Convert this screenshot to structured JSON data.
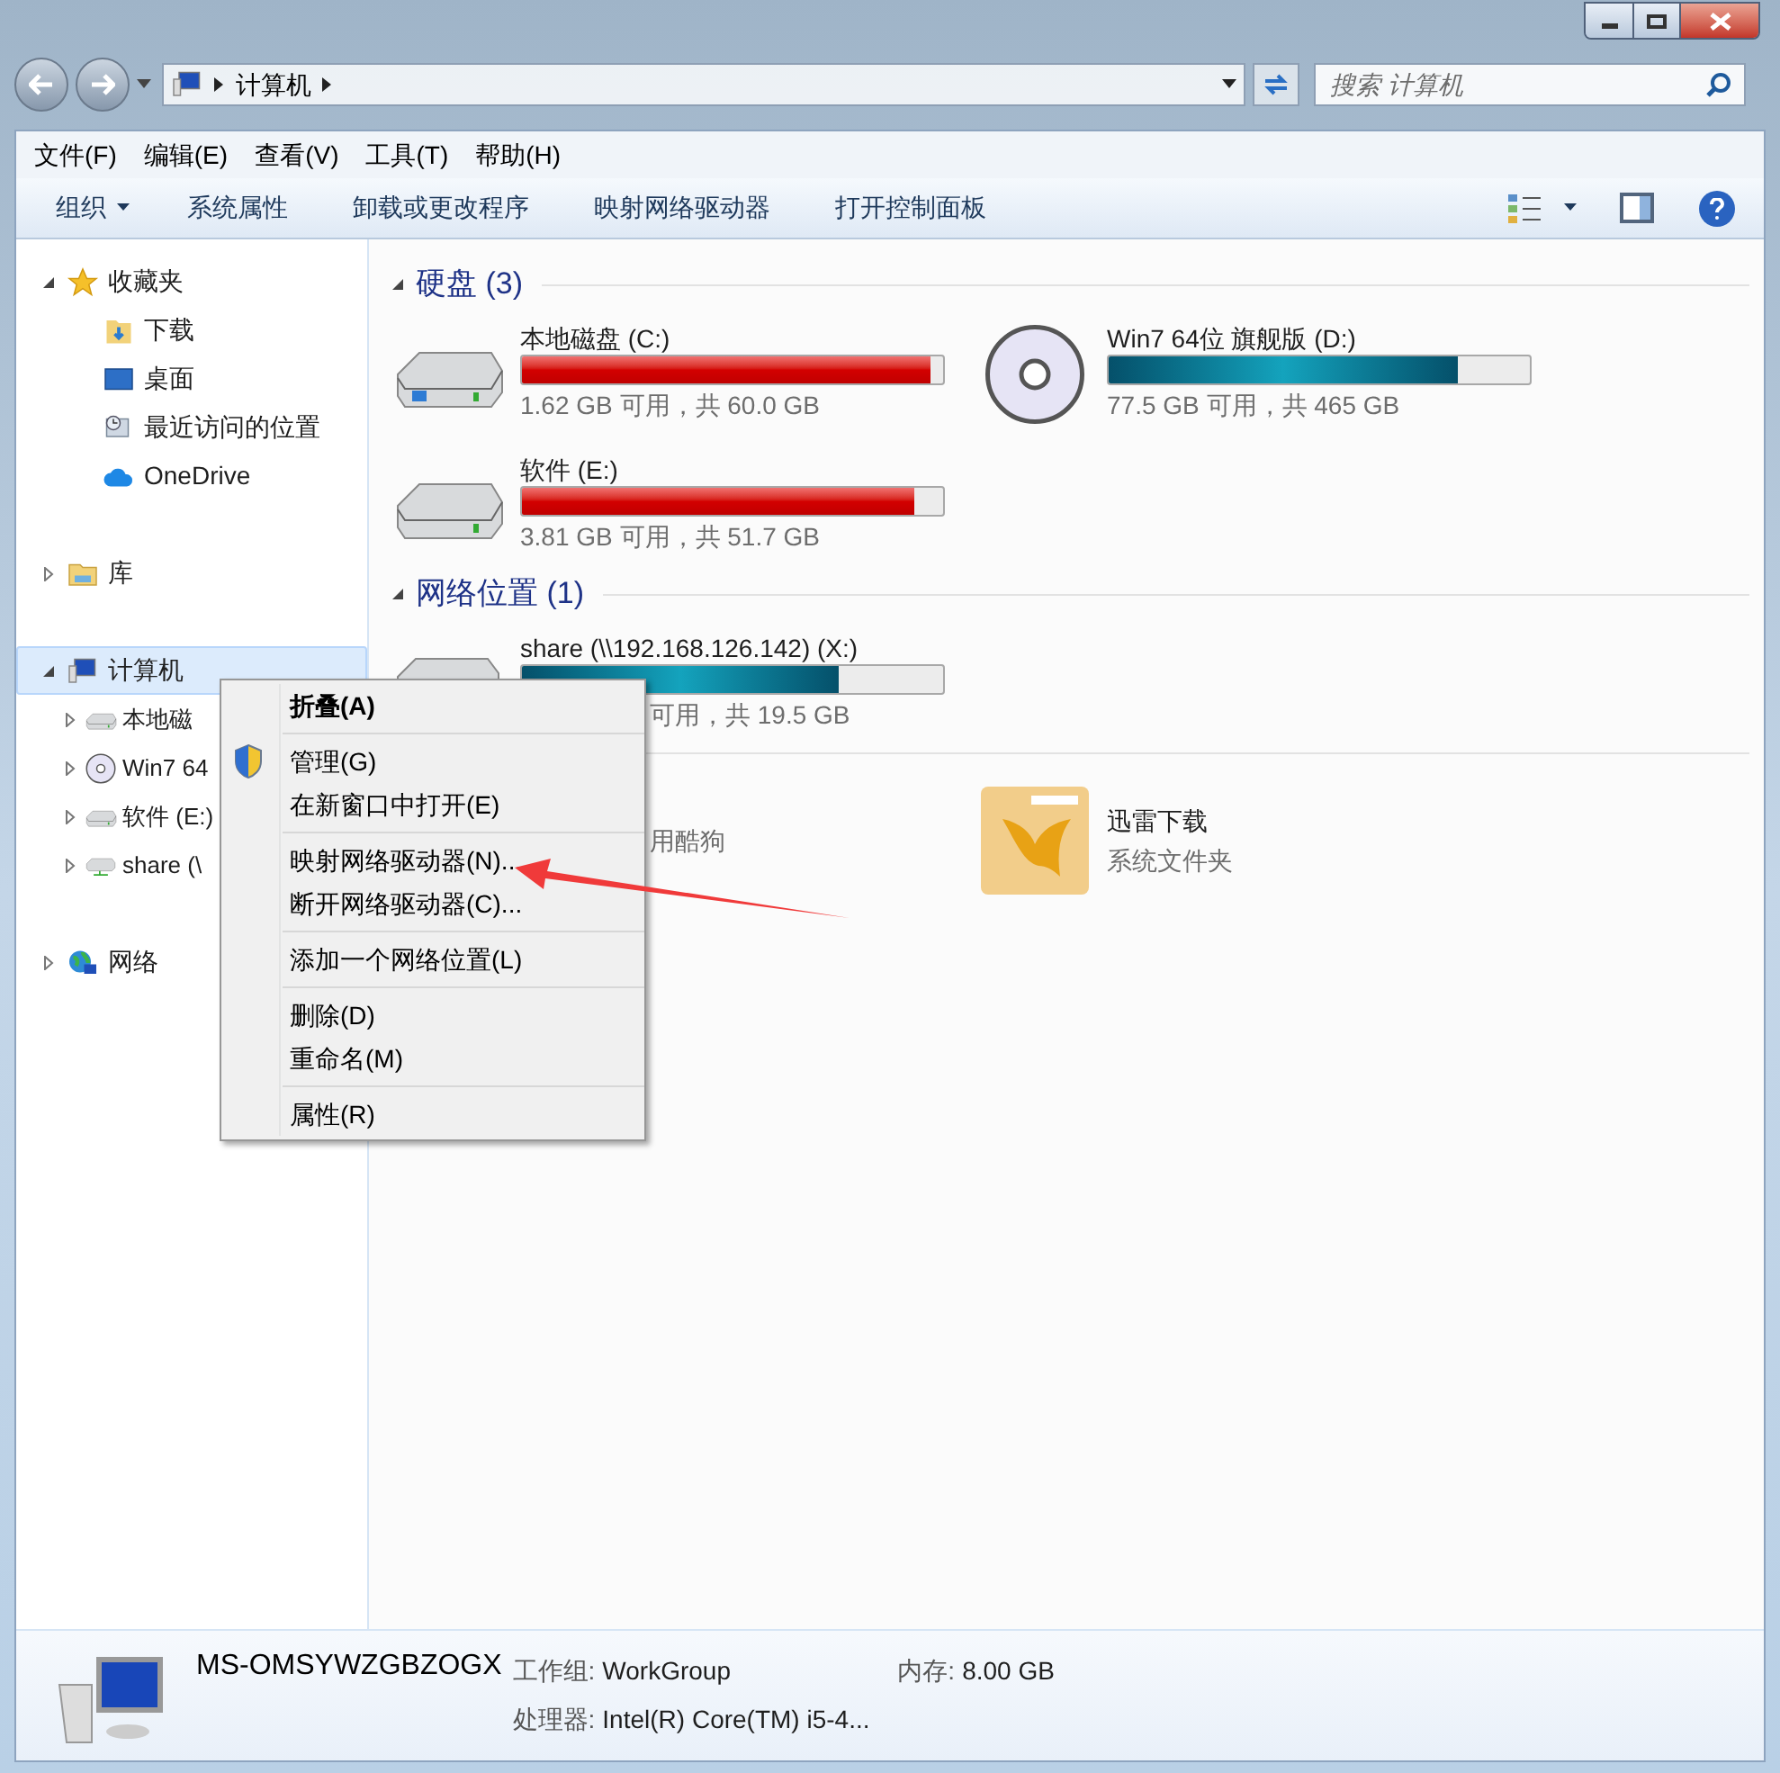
{
  "window": {
    "address": [
      "计算机"
    ],
    "search_placeholder": "搜索 计算机"
  },
  "menu_bar": [
    "文件(F)",
    "编辑(E)",
    "查看(V)",
    "工具(T)",
    "帮助(H)"
  ],
  "toolbar": [
    {
      "label": "组织",
      "kind": "dropdown"
    },
    {
      "label": "系统属性",
      "kind": "button"
    },
    {
      "label": "卸载或更改程序",
      "kind": "button"
    },
    {
      "label": "映射网络驱动器",
      "kind": "button"
    },
    {
      "label": "打开控制面板",
      "kind": "button"
    }
  ],
  "sidebar": [
    {
      "label": "收藏夹",
      "kind": "favorites",
      "expanded": true,
      "selected": false,
      "children": [
        {
          "label": "下载",
          "kind": "downloads",
          "selected": false
        },
        {
          "label": "桌面",
          "kind": "desktop",
          "selected": false
        },
        {
          "label": "最近访问的位置",
          "kind": "recent",
          "selected": false
        },
        {
          "label": "OneDrive",
          "kind": "cloud",
          "selected": false
        }
      ]
    },
    {
      "label": "库",
      "kind": "library",
      "expanded": false,
      "selected": false
    },
    {
      "label": "计算机",
      "kind": "computer",
      "expanded": true,
      "selected": true,
      "children": [
        {
          "label": "本地磁",
          "kind": "disk",
          "expanded": false,
          "selected": false
        },
        {
          "label": "Win7 64",
          "kind": "disc",
          "expanded": false,
          "selected": false
        },
        {
          "label": "软件 (E:)",
          "kind": "disk",
          "expanded": false,
          "selected": false
        },
        {
          "label": "share (\\",
          "kind": "network",
          "expanded": false,
          "selected": false
        }
      ]
    },
    {
      "label": "网络",
      "kind": "globe",
      "expanded": false,
      "selected": false
    }
  ],
  "sections": [
    {
      "title": "硬盘 (3)",
      "items": [
        {
          "kind": "system_disk",
          "name": "本地磁盘 (C:)",
          "level": 0.97,
          "low_space": true,
          "free": "1.62 GB 可用，共 60.0 GB"
        },
        {
          "kind": "disc",
          "name": "Win7 64位 旗舰版 (D:)",
          "level": 0.83,
          "low_space": false,
          "free": "77.5 GB 可用，共 465 GB"
        },
        {
          "kind": "disk",
          "name": "软件 (E:)",
          "level": 0.93,
          "low_space": true,
          "free": "3.81 GB 可用，共 51.7 GB"
        }
      ]
    },
    {
      "title": "网络位置 (1)",
      "items": [
        {
          "kind": "network",
          "name": "share (\\\\192.168.126.142) (X:)",
          "level": 0.75,
          "low_space": false,
          "free": "可用，共 19.5 GB"
        }
      ]
    },
    {
      "items": [
        {
          "kind": "hidden_folder",
          "subtitle": "用酷狗"
        },
        {
          "kind": "folder",
          "name": "迅雷下载",
          "subtitle": "系统文件夹"
        }
      ]
    }
  ],
  "context_menu": [
    [
      {
        "label": "折叠(A)",
        "bold": true
      }
    ],
    [
      {
        "label": "管理(G)",
        "shield": true
      },
      {
        "label": "在新窗口中打开(E)"
      }
    ],
    [
      {
        "label": "映射网络驱动器(N)..."
      },
      {
        "label": "断开网络驱动器(C)..."
      }
    ],
    [
      {
        "label": "添加一个网络位置(L)"
      }
    ],
    [
      {
        "label": "删除(D)"
      },
      {
        "label": "重命名(M)"
      }
    ],
    [
      {
        "label": "属性(R)"
      }
    ]
  ],
  "details": {
    "name": "MS-OMSYWZGBZOGX",
    "fields": [
      {
        "label": "工作组:",
        "value": "WorkGroup"
      },
      {
        "label": "内存:",
        "value": "8.00 GB"
      },
      {
        "label": "处理器:",
        "value": "Intel(R) Core(TM) i5-4..."
      }
    ]
  }
}
